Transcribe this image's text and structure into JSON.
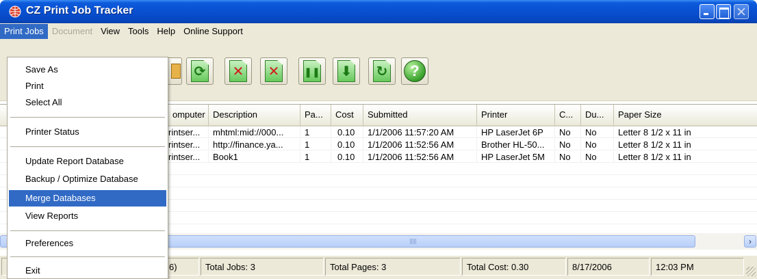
{
  "window": {
    "title": "CZ Print Job Tracker",
    "app_icon": "printer-globe-icon",
    "controls": [
      "minimize-icon",
      "maximize-icon",
      "close-icon"
    ]
  },
  "menubar": {
    "items": [
      "Print Jobs",
      "Document",
      "View",
      "Tools",
      "Help",
      "Online Support"
    ],
    "open": "Print Jobs",
    "disabled": [
      "Document"
    ]
  },
  "dropdown": {
    "groups": [
      [
        "Save As",
        "Print",
        "Select All"
      ],
      [
        "Printer Status"
      ],
      [
        "Update Report Database",
        "Backup / Optimize Database",
        "Merge Databases",
        "View Reports"
      ],
      [
        "Preferences"
      ],
      [
        "Exit"
      ]
    ],
    "highlighted": "Merge Databases"
  },
  "toolbar": {
    "buttons": [
      "folder-icon",
      "refresh-icon",
      "delete-icon",
      "delete-all-icon",
      "pause-icon",
      "download-icon",
      "reprint-icon",
      "help-icon"
    ],
    "help_glyph": "?"
  },
  "grid": {
    "columns": [
      "omputer",
      "Description",
      "Pa...",
      "Cost",
      "Submitted",
      "Printer",
      "C...",
      "Du...",
      "Paper Size"
    ],
    "rows": [
      [
        "rintser...",
        "mhtml:mid://000...",
        "1",
        "0.10",
        "1/1/2006 11:57:20 AM",
        "HP LaserJet 6P",
        "No",
        "No",
        "Letter 8 1/2 x 11 in"
      ],
      [
        "rintser...",
        "http://finance.ya...",
        "1",
        "0.10",
        "1/1/2006 11:52:56 AM",
        "Brother HL-50...",
        "No",
        "No",
        "Letter 8 1/2 x 11 in"
      ],
      [
        "rintser...",
        "Book1",
        "1",
        "0.10",
        "1/1/2006 11:52:56 AM",
        "HP LaserJet 5M",
        "No",
        "No",
        "Letter 8 1/2 x 11 in"
      ]
    ],
    "hscroll_arrow": "›"
  },
  "statusbar": {
    "panels": [
      "6)",
      "Total Jobs: 3",
      "Total Pages: 3",
      "Total Cost: 0.30",
      "8/17/2006",
      "12:03 PM"
    ]
  },
  "colors": {
    "title_bar": "#0850d0",
    "menu_highlight": "#316ac5",
    "chrome": "#ece9d8"
  }
}
